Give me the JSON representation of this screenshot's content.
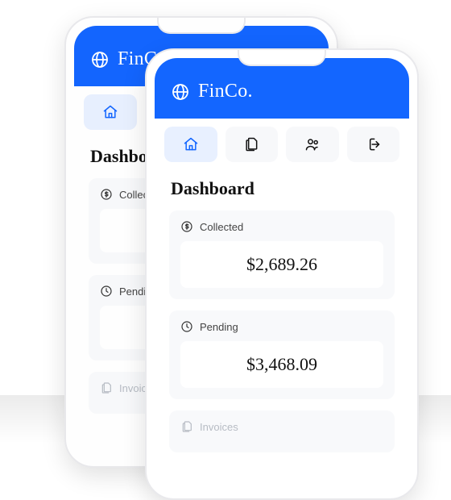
{
  "brand": {
    "name": "FinCo."
  },
  "nav": {
    "items": [
      {
        "name": "home",
        "active": true
      },
      {
        "name": "documents",
        "active": false
      },
      {
        "name": "users",
        "active": false
      },
      {
        "name": "logout",
        "active": false
      }
    ]
  },
  "page": {
    "title": "Dashboard"
  },
  "cards": {
    "collected": {
      "label": "Collected",
      "value": "$2,689.26"
    },
    "pending": {
      "label": "Pending",
      "value": "$3,468.09"
    },
    "invoices": {
      "label": "Invoices"
    }
  },
  "colors": {
    "accent": "#1366ff"
  }
}
